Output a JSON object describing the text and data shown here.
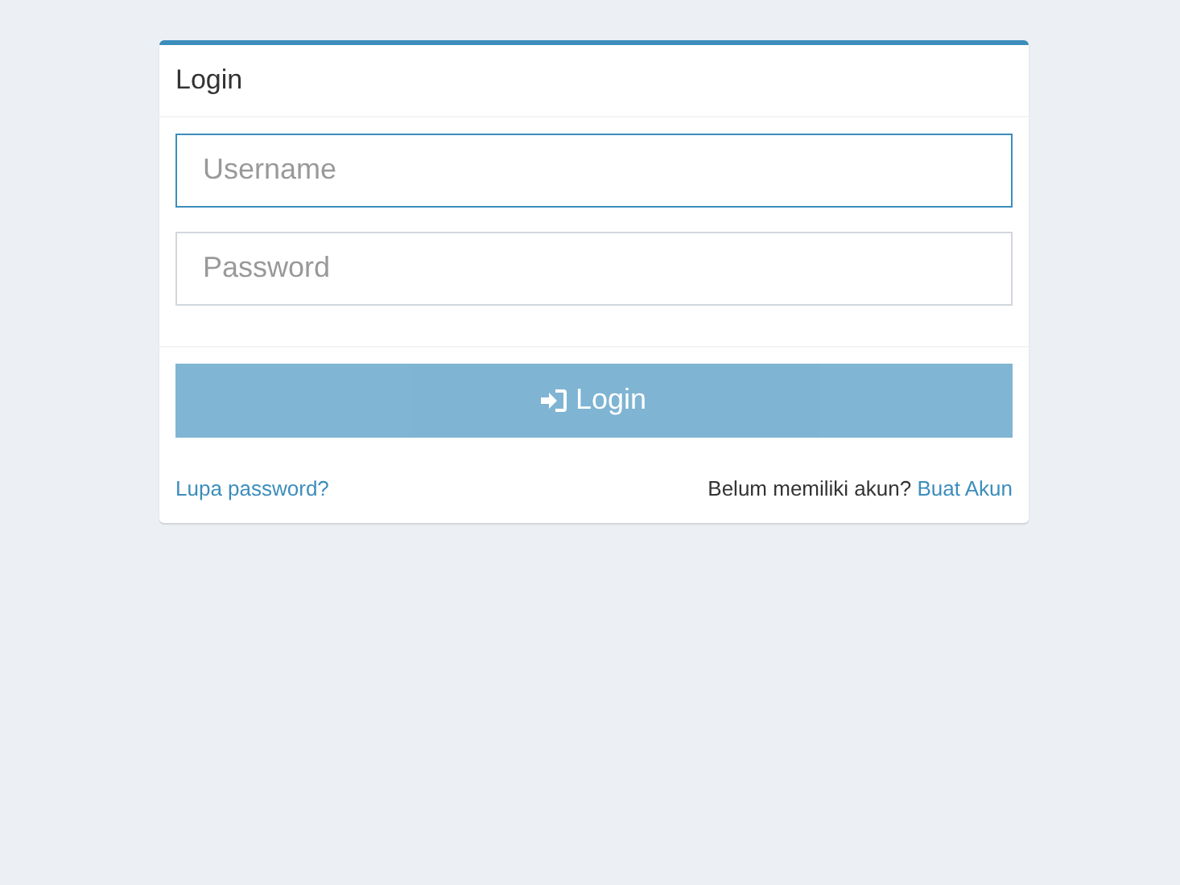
{
  "card": {
    "title": "Login"
  },
  "fields": [
    {
      "placeholder": "Username",
      "focused": true
    },
    {
      "placeholder": "Password",
      "focused": false
    }
  ],
  "login_button": {
    "label": "Login",
    "disabled": true
  },
  "footer": {
    "forgot_link": "Lupa password?",
    "signup_prompt": "Belum memiliki akun?",
    "signup_link": "Buat Akun"
  }
}
